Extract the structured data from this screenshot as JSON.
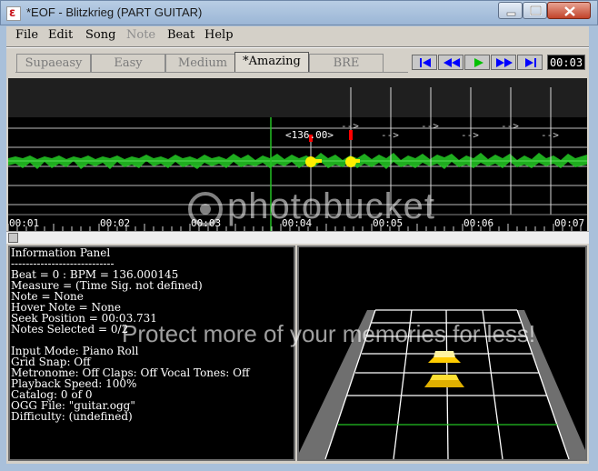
{
  "window": {
    "title": "*EOF - Blitzkrieg (PART GUITAR)",
    "icon": "eof-app-icon",
    "controls": [
      "minimize-icon",
      "maximize-icon",
      "close-icon"
    ]
  },
  "menu": {
    "items": [
      {
        "label": "File",
        "enabled": true
      },
      {
        "label": "Edit",
        "enabled": true
      },
      {
        "label": "Song",
        "enabled": true
      },
      {
        "label": "Note",
        "enabled": false
      },
      {
        "label": "Beat",
        "enabled": true
      },
      {
        "label": "Help",
        "enabled": true
      }
    ]
  },
  "tabs": [
    {
      "label": "Supaeasy",
      "active": false
    },
    {
      "label": "Easy",
      "active": false
    },
    {
      "label": "Medium",
      "active": false
    },
    {
      "label": "*Amazing",
      "active": true
    },
    {
      "label": "BRE",
      "active": false
    }
  ],
  "transport": {
    "buttons": [
      "skip-to-start-icon",
      "rewind-icon",
      "play-icon",
      "fast-forward-icon",
      "skip-to-end-icon"
    ],
    "time": "00:03",
    "accent": "#0000ff",
    "play_color": "#00c000"
  },
  "piano_roll": {
    "tempo_marker": "<136.00>",
    "beat_arrow": "-->",
    "timeline": [
      "00:01",
      "00:02",
      "00:03",
      "00:04",
      "00:05",
      "00:06",
      "00:07"
    ],
    "waveform_color": "#22c022",
    "note_color": "#ffee00",
    "marker_color": "#ff0000"
  },
  "info_panel": {
    "lines": [
      "Information Panel",
      "----------------------------",
      "Beat = 0 : BPM = 136.000145",
      "Measure = (Time Sig. not defined)",
      "Note = None",
      "Hover Note = None",
      "Seek Position = 00:03.731",
      "Notes Selected = 0/2",
      "",
      "Input Mode: Piano Roll",
      "Grid Snap: Off",
      "Metronome: Off Claps: Off Vocal Tones: Off",
      "Playback Speed: 100%",
      "Catalog: 0 of 0",
      "OGG File: \"guitar.ogg\"",
      "Difficulty: (undefined)"
    ]
  },
  "watermark": {
    "brand": "photobucket",
    "slogan": "Protect more of your memories for less!"
  }
}
